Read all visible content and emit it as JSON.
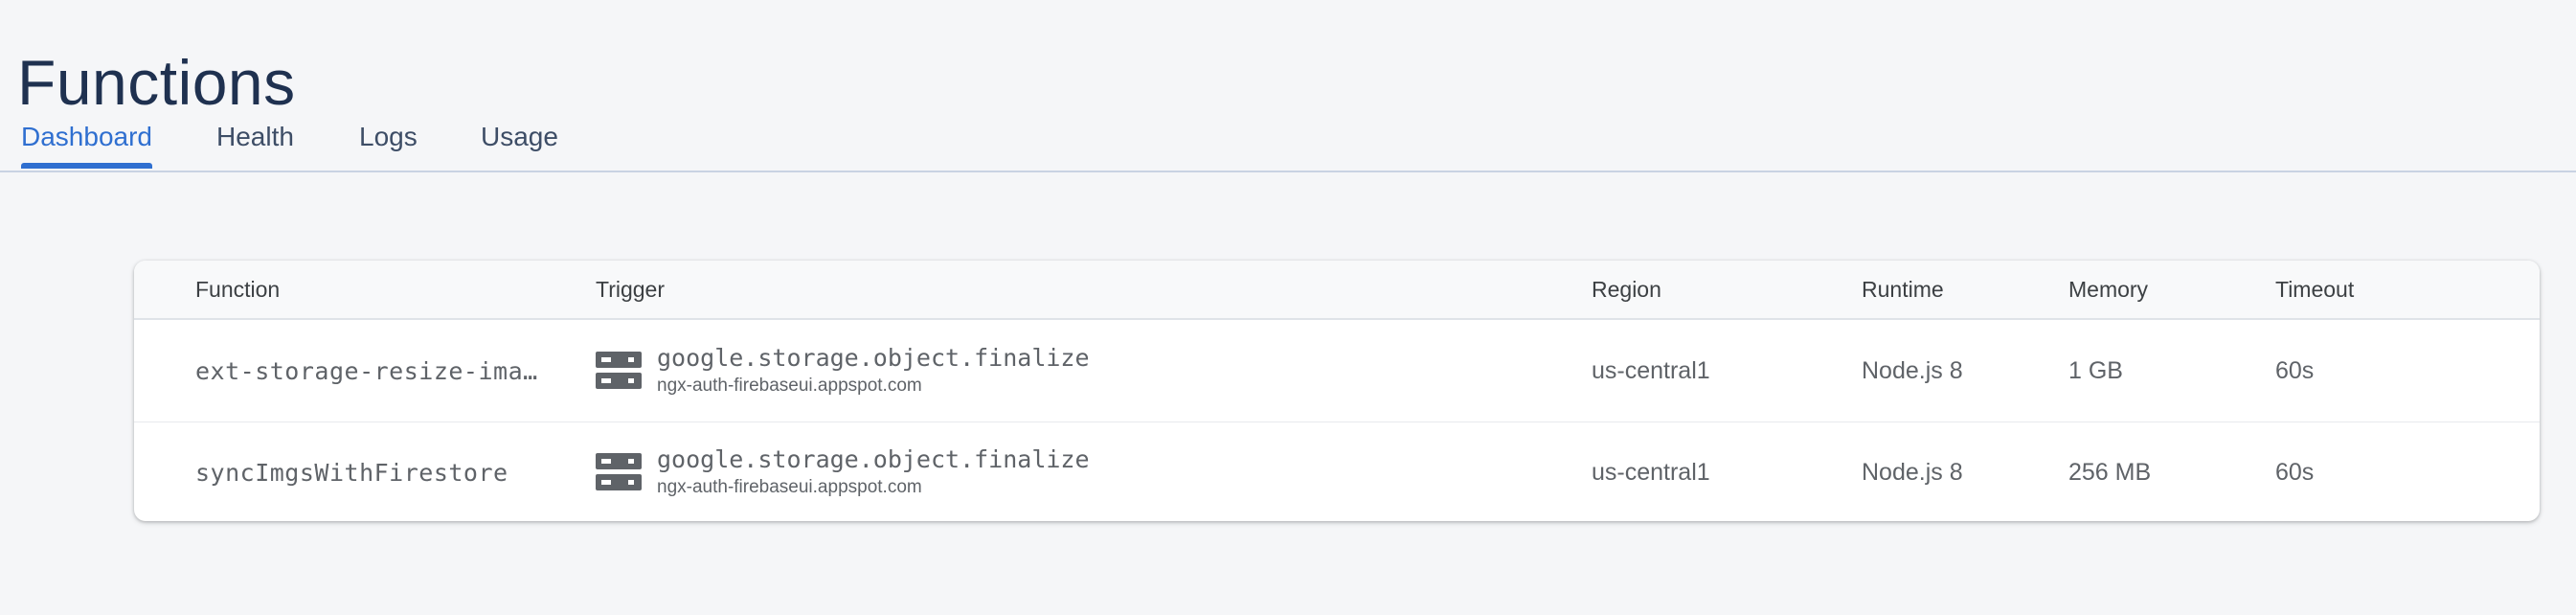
{
  "page": {
    "title": "Functions"
  },
  "tabs": [
    {
      "label": "Dashboard",
      "active": true
    },
    {
      "label": "Health",
      "active": false
    },
    {
      "label": "Logs",
      "active": false
    },
    {
      "label": "Usage",
      "active": false
    }
  ],
  "table": {
    "columns": [
      "Function",
      "Trigger",
      "Region",
      "Runtime",
      "Memory",
      "Timeout"
    ],
    "rows": [
      {
        "function": "ext-storage-resize-ima…",
        "trigger_icon": "storage-bucket-icon",
        "trigger_event": "google.storage.object.finalize",
        "trigger_resource": "ngx-auth-firebaseui.appspot.com",
        "region": "us-central1",
        "runtime": "Node.js 8",
        "memory": "1 GB",
        "timeout": "60s"
      },
      {
        "function": "syncImgsWithFirestore",
        "trigger_icon": "storage-bucket-icon",
        "trigger_event": "google.storage.object.finalize",
        "trigger_resource": "ngx-auth-firebaseui.appspot.com",
        "region": "us-central1",
        "runtime": "Node.js 8",
        "memory": "256 MB",
        "timeout": "60s"
      }
    ]
  },
  "colors": {
    "accent": "#2f6fd0",
    "title": "#1f3150",
    "background": "#f5f6f8"
  }
}
